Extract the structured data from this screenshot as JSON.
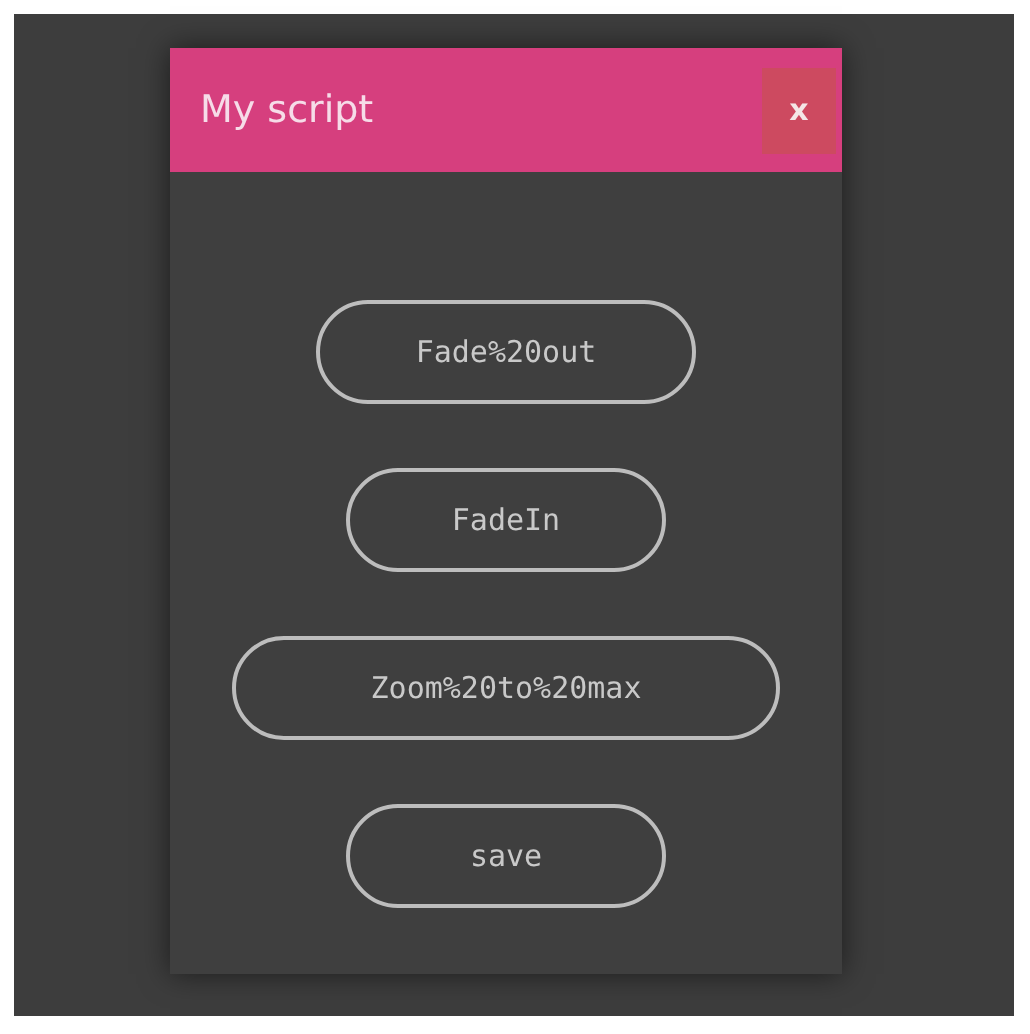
{
  "window": {
    "title": "My script",
    "close_label": "x"
  },
  "buttons": [
    {
      "label": "Fade%20out"
    },
    {
      "label": "FadeIn"
    },
    {
      "label": "Zoom%20to%20max"
    },
    {
      "label": "save"
    }
  ]
}
